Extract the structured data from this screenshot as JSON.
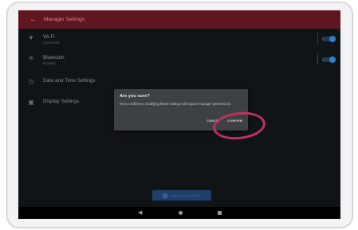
{
  "app_bar": {
    "back_icon": "arrow-left-icon",
    "title": "Manager Settings"
  },
  "settings": [
    {
      "icon": "wifi-icon",
      "title": "Wi-Fi",
      "subtitle": "Connected",
      "has_toggle": true,
      "toggle_on": true
    },
    {
      "icon": "bluetooth-icon",
      "title": "Bluetooth",
      "subtitle": "Enabled",
      "has_toggle": true,
      "toggle_on": true
    },
    {
      "icon": "clock-icon",
      "title": "Date and Time Settings",
      "subtitle": "",
      "has_toggle": false
    },
    {
      "icon": "display-icon",
      "title": "Display Settings",
      "subtitle": "",
      "has_toggle": false
    }
  ],
  "dialog": {
    "title": "Are you sure?",
    "message": "Once confirmed, modifying these settings will require manager permissions.",
    "cancel_label": "CANCEL",
    "confirm_label": "CONFIRM"
  },
  "bottom_action": {
    "icon": "lock-icon",
    "label": "Confirm and Lock Tabs"
  },
  "nav_bar": {
    "back_icon": "nav-back-icon",
    "home_icon": "nav-home-icon",
    "recents_icon": "nav-recents-icon"
  },
  "colors": {
    "app_bar": "#5f1620",
    "accent": "#2f7fc6",
    "highlight_ring": "#c0305e",
    "background": "#111416"
  }
}
